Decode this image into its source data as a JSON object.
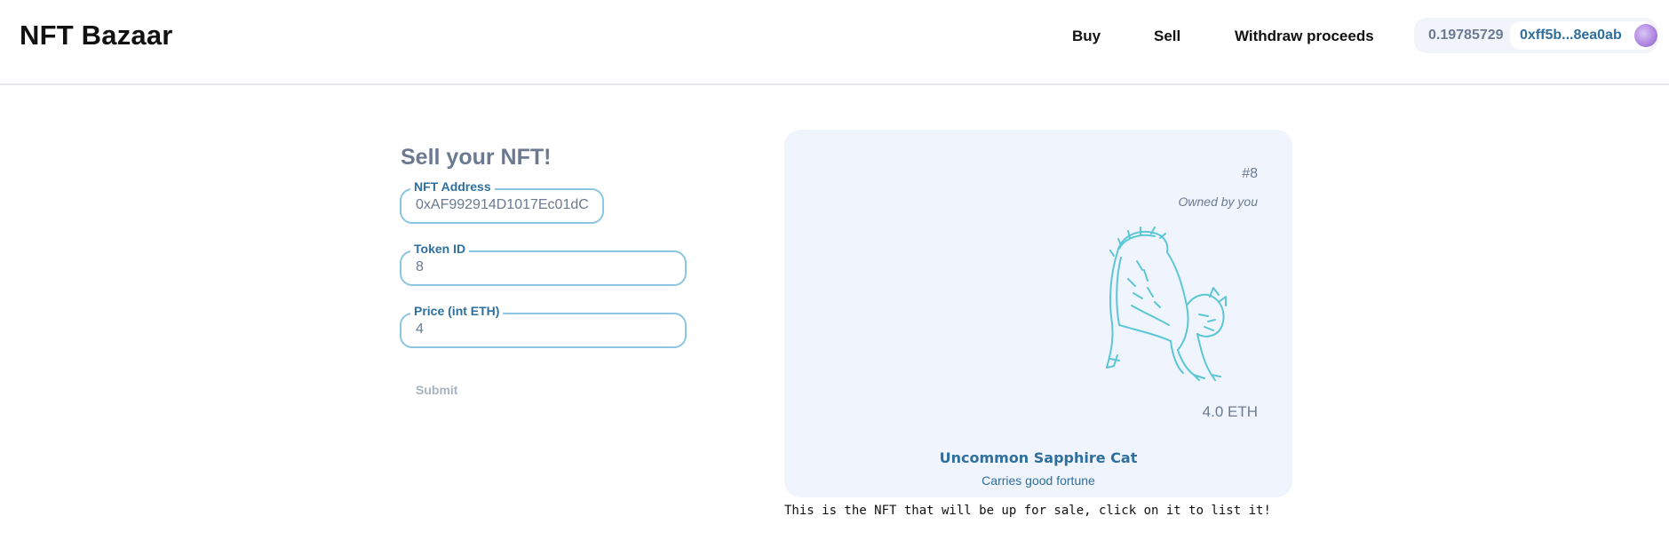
{
  "header": {
    "brand": "NFT Bazaar",
    "nav": {
      "buy": "Buy",
      "sell": "Sell",
      "withdraw": "Withdraw proceeds"
    },
    "account": {
      "balance": "0.19785729",
      "address": "0xff5b...8ea0ab"
    }
  },
  "form": {
    "title": "Sell your NFT!",
    "nft_address": {
      "label": "NFT Address",
      "value": "0xAF992914D1017Ec01dC"
    },
    "token_id": {
      "label": "Token ID",
      "value": "8"
    },
    "price": {
      "label": "Price (int ETH)",
      "value": "4"
    },
    "submit_label": "Submit"
  },
  "nft_card": {
    "token_id": "#8",
    "owner": "Owned by you",
    "price": "4.0 ETH",
    "name": "Uncommon Sapphire Cat",
    "description": "Carries good fortune",
    "image_icon": "cat-sketch",
    "accent_color": "#5bc6d6"
  },
  "caption": "This is the NFT that will be up for sale, click on it to list it!"
}
